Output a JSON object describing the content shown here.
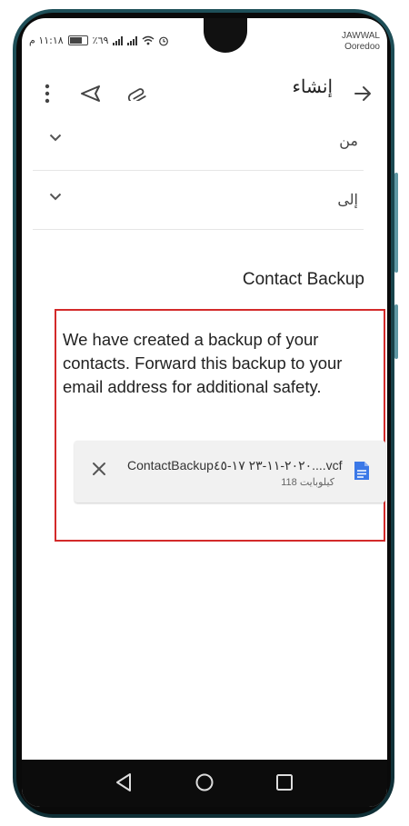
{
  "status_bar": {
    "time": "١١:١٨ م",
    "battery": "٪٦٩",
    "carrier_line1": "JAWWAL",
    "carrier_line2": "Ooredoo"
  },
  "app_bar": {
    "title": "إنشاء",
    "icons": [
      "back-arrow-icon",
      "paperclip-icon",
      "send-icon",
      "more-vert-icon"
    ]
  },
  "compose": {
    "from_label": "من",
    "to_label": "إلى",
    "subject": "Contact Backup",
    "body": "We have created a backup of your contacts. Forward this backup to your email address for additional safety.",
    "attachment": {
      "name": "ContactBackup٢٠٢٠-١١-٢٣ ١٧-٤٥....vcf",
      "size": "118 كيلوبايت",
      "icon": "document-icon"
    }
  },
  "nav_bar": {
    "icons": [
      "nav-back-icon",
      "nav-home-icon",
      "nav-recents-icon"
    ]
  },
  "colors": {
    "highlight_border": "#d32a2a",
    "doc_icon": "#3b78e7",
    "phone_frame": "#1e4f58"
  }
}
